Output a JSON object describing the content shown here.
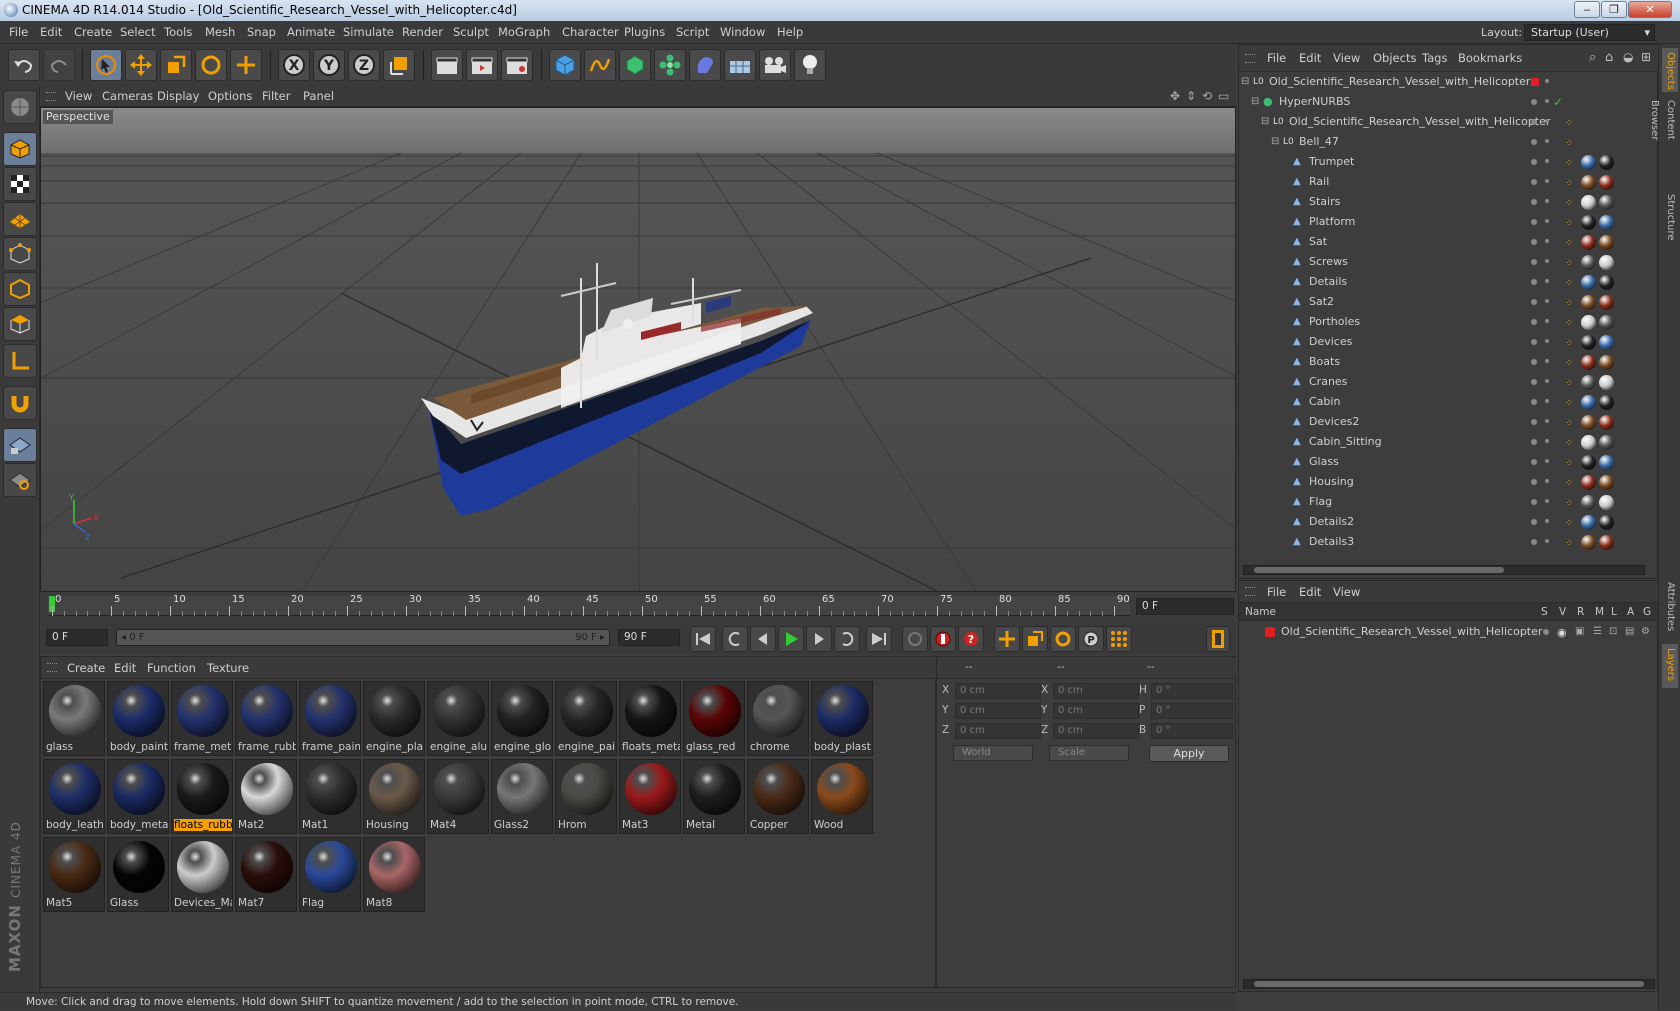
{
  "window": {
    "title": "CINEMA 4D R14.014 Studio - [Old_Scientific_Research_Vessel_with_Helicopter.c4d]",
    "minimize": "‒",
    "maximize": "❐",
    "close": "✕"
  },
  "menubar": {
    "items": [
      "File",
      "Edit",
      "Create",
      "Select",
      "Tools",
      "Mesh",
      "Snap",
      "Animate",
      "Simulate",
      "Render",
      "Sculpt",
      "MoGraph",
      "Character",
      "Plugins",
      "Script",
      "Window",
      "Help"
    ],
    "layout_label": "Layout:",
    "layout_value": "Startup (User)"
  },
  "viewport": {
    "menu": [
      "View",
      "Cameras",
      "Display",
      "Options",
      "Filter",
      "Panel"
    ],
    "camera": "Perspective"
  },
  "timeline": {
    "ticks": [
      "0",
      "5",
      "10",
      "15",
      "20",
      "25",
      "30",
      "35",
      "40",
      "45",
      "50",
      "55",
      "60",
      "65",
      "70",
      "75",
      "80",
      "85",
      "90"
    ],
    "current_frame": "0 F",
    "start": "0 F",
    "range_start": "◂ 0 F",
    "range_end": "90 F ▸",
    "end": "90 F"
  },
  "materials": {
    "menu": [
      "Create",
      "Edit",
      "Function",
      "Texture"
    ],
    "items": [
      {
        "name": "glass",
        "color": "#7a7a7a"
      },
      {
        "name": "body_paint",
        "color": "#1c2d6b"
      },
      {
        "name": "frame_meta",
        "color": "#24336f"
      },
      {
        "name": "frame_rubb",
        "color": "#24336f"
      },
      {
        "name": "frame_pain",
        "color": "#24336f"
      },
      {
        "name": "engine_pla",
        "color": "#2b2b2b"
      },
      {
        "name": "engine_alu",
        "color": "#333333"
      },
      {
        "name": "engine_glo",
        "color": "#222222"
      },
      {
        "name": "engine_pai",
        "color": "#262626"
      },
      {
        "name": "floats_meta",
        "color": "#151515"
      },
      {
        "name": "glass_red",
        "color": "#5a0505"
      },
      {
        "name": "chrome",
        "color": "#555555"
      },
      {
        "name": "body_plast",
        "color": "#1d2c66"
      },
      {
        "name": "body_leath",
        "color": "#1e2e68"
      },
      {
        "name": "body_meta",
        "color": "#1b2a63"
      },
      {
        "name": "floats_rubb",
        "color": "#1a1a1a",
        "selected": true
      },
      {
        "name": "Mat2",
        "color": "#d8d8d8"
      },
      {
        "name": "Mat1",
        "color": "#2e2e2e"
      },
      {
        "name": "Housing",
        "color": "#6a5a4a"
      },
      {
        "name": "Mat4",
        "color": "#3a3a3a"
      },
      {
        "name": "Glass2",
        "color": "#777777"
      },
      {
        "name": "Hrom",
        "color": "#4a4a44"
      },
      {
        "name": "Mat3",
        "color": "#9a1a1a"
      },
      {
        "name": "Metal",
        "color": "#1e1e1e"
      },
      {
        "name": "Copper",
        "color": "#4a2a18"
      },
      {
        "name": "Wood",
        "color": "#8a4a1c"
      },
      {
        "name": "Mat5",
        "color": "#4a2a14"
      },
      {
        "name": "Glass",
        "color": "#050505"
      },
      {
        "name": "Devices_Ma",
        "color": "#cccccc"
      },
      {
        "name": "Mat7",
        "color": "#2a0e0a"
      },
      {
        "name": "Flag",
        "color": "#2a4a9a"
      },
      {
        "name": "Mat8",
        "color": "#aa6666"
      }
    ]
  },
  "coords": {
    "headers": [
      "--",
      "--",
      "--"
    ],
    "rows": [
      {
        "a": "X",
        "av": "0 cm",
        "b": "X",
        "bv": "0 cm",
        "c": "H",
        "cv": "0 °"
      },
      {
        "a": "Y",
        "av": "0 cm",
        "b": "Y",
        "bv": "0 cm",
        "c": "P",
        "cv": "0 °"
      },
      {
        "a": "Z",
        "av": "0 cm",
        "b": "Z",
        "bv": "0 cm",
        "c": "B",
        "cv": "0 °"
      }
    ],
    "mode": "World",
    "transform": "Scale",
    "apply": "Apply"
  },
  "status": "Move: Click and drag to move elements. Hold down SHIFT to quantize movement / add to the selection in point mode, CTRL to remove.",
  "objects": {
    "menu": [
      "File",
      "Edit",
      "View",
      "Objects",
      "Tags",
      "Bookmarks"
    ],
    "tree": [
      {
        "name": "Old_Scientific_Research_Vessel_with_Helicopter",
        "level": 0
      },
      {
        "name": "HyperNURBS",
        "level": 1
      },
      {
        "name": "Old_Scientific_Research_Vessel_with_Helicopter",
        "level": 2
      },
      {
        "name": "Bell_47",
        "level": 3
      },
      {
        "name": "Trumpet",
        "level": 4
      },
      {
        "name": "Rail",
        "level": 4
      },
      {
        "name": "Stairs",
        "level": 4
      },
      {
        "name": "Platform",
        "level": 4
      },
      {
        "name": "Sat",
        "level": 4
      },
      {
        "name": "Screws",
        "level": 4
      },
      {
        "name": "Details",
        "level": 4
      },
      {
        "name": "Sat2",
        "level": 4
      },
      {
        "name": "Portholes",
        "level": 4
      },
      {
        "name": "Devices",
        "level": 4
      },
      {
        "name": "Boats",
        "level": 4
      },
      {
        "name": "Cranes",
        "level": 4
      },
      {
        "name": "Cabin",
        "level": 4
      },
      {
        "name": "Devices2",
        "level": 4
      },
      {
        "name": "Cabin_Sitting",
        "level": 4
      },
      {
        "name": "Glass",
        "level": 4
      },
      {
        "name": "Housing",
        "level": 4
      },
      {
        "name": "Flag",
        "level": 4
      },
      {
        "name": "Details2",
        "level": 4
      },
      {
        "name": "Details3",
        "level": 4
      }
    ]
  },
  "layers": {
    "menu": [
      "File",
      "Edit",
      "View"
    ],
    "name_header": "Name",
    "cols": [
      "S",
      "V",
      "R",
      "M",
      "L",
      "A",
      "G"
    ],
    "item": "Old_Scientific_Research_Vessel_with_Helicopter"
  },
  "right_tabs": [
    "Objects",
    "Content Browser",
    "Structure",
    "Attributes",
    "Layers"
  ],
  "brand": {
    "maxon": "MAXON",
    "cinema": "CINEMA 4D"
  }
}
